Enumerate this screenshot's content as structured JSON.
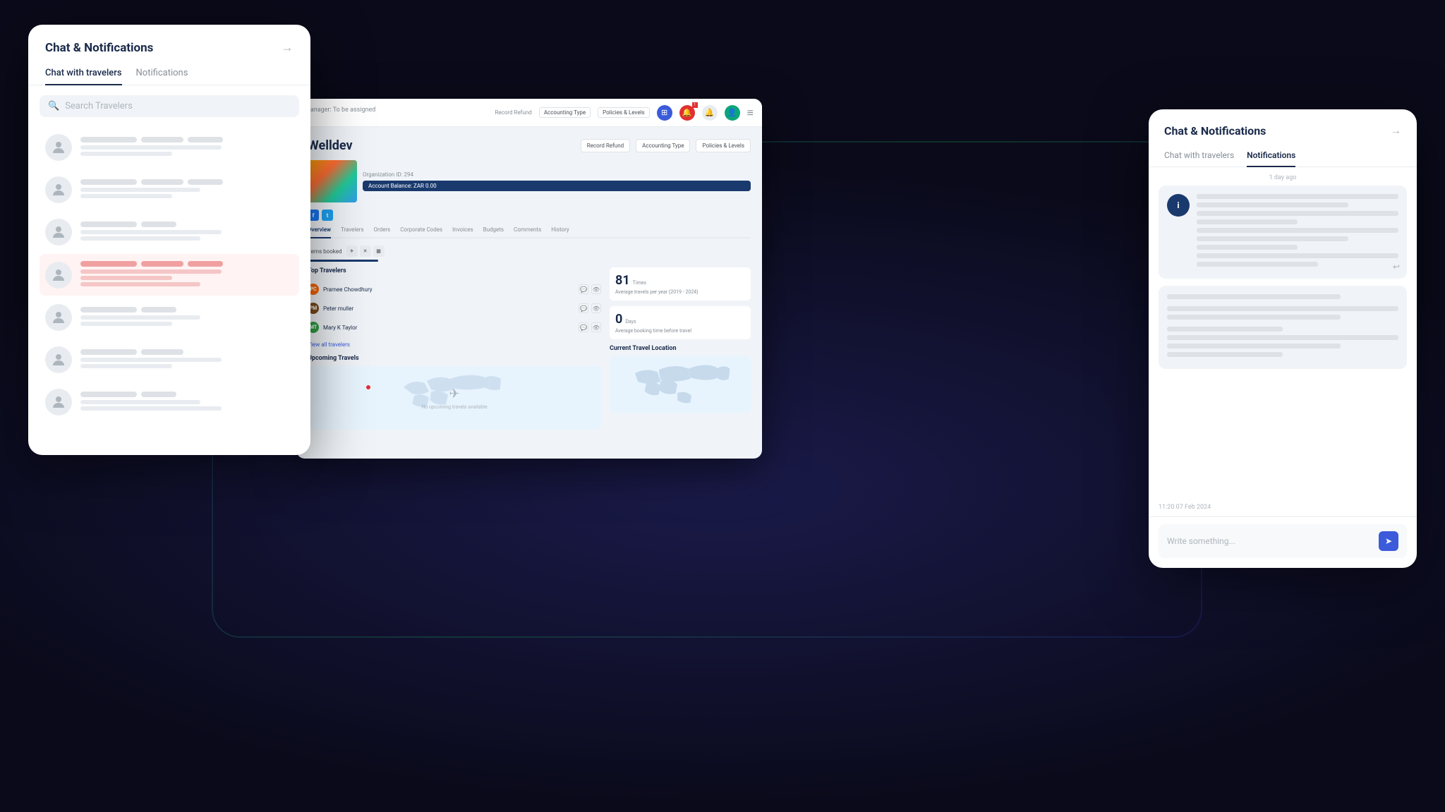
{
  "app": {
    "bg": "#0a0a1a"
  },
  "left_panel": {
    "title": "Chat & Notifications",
    "arrow": "→",
    "tabs": [
      {
        "label": "Chat with travelers",
        "active": true
      },
      {
        "label": "Notifications",
        "active": false
      }
    ],
    "search_placeholder": "Search Travelers",
    "chat_items": [
      {
        "highlighted": false
      },
      {
        "highlighted": false
      },
      {
        "highlighted": false
      },
      {
        "highlighted": true
      },
      {
        "highlighted": false
      },
      {
        "highlighted": false
      },
      {
        "highlighted": false
      }
    ]
  },
  "right_panel": {
    "title": "Chat & Notifications",
    "arrow": "→",
    "tabs": [
      {
        "label": "Chat with travelers",
        "active": false
      },
      {
        "label": "Notifications",
        "active": true
      }
    ],
    "timestamp_section": "1 day ago",
    "notification_timestamp": "11:20 07 Feb 2024",
    "write_placeholder": "Write something..."
  },
  "dashboard": {
    "company": "Welldev",
    "breadcrumb": "Manager: To be assigned",
    "record_refund": "Record Refund",
    "accounting_type": "Accounting Type",
    "policies_levels": "Policies & Levels",
    "org_id": "Organization ID: 294",
    "account_balance": "Account Balance: ZAR 0.00",
    "tabs": [
      "Overview",
      "Travelers",
      "Orders",
      "Corporate Codes",
      "Invoices",
      "Budgets",
      "Comments",
      "History"
    ],
    "active_tab": "Overview",
    "items_booked_label": "Items booked",
    "top_travelers_label": "Top Travelers",
    "travelers": [
      {
        "name": "Pramee Chowdhury",
        "color": "#f76707",
        "initials": "PC"
      },
      {
        "name": "Peter muller",
        "color": "#7c4a1e",
        "initials": "PM"
      },
      {
        "name": "Mary K Taylor",
        "color": "#2f9e44",
        "initials": "MT"
      }
    ],
    "view_all": "View all travelers",
    "stat1_number": "81",
    "stat1_unit": "Times",
    "stat1_label": "Average travels per year (2019 - 2024)",
    "stat2_number": "0",
    "stat2_unit": "Days",
    "stat2_label": "Average booking time before travel",
    "upcoming_label": "Upcoming Travels",
    "current_location_label": "Current Travel Location",
    "no_upcoming": "No upcoming travels available"
  },
  "topbar": {
    "icons": [
      "⊞",
      "🔔",
      "🔔",
      "👤",
      "≡"
    ]
  }
}
